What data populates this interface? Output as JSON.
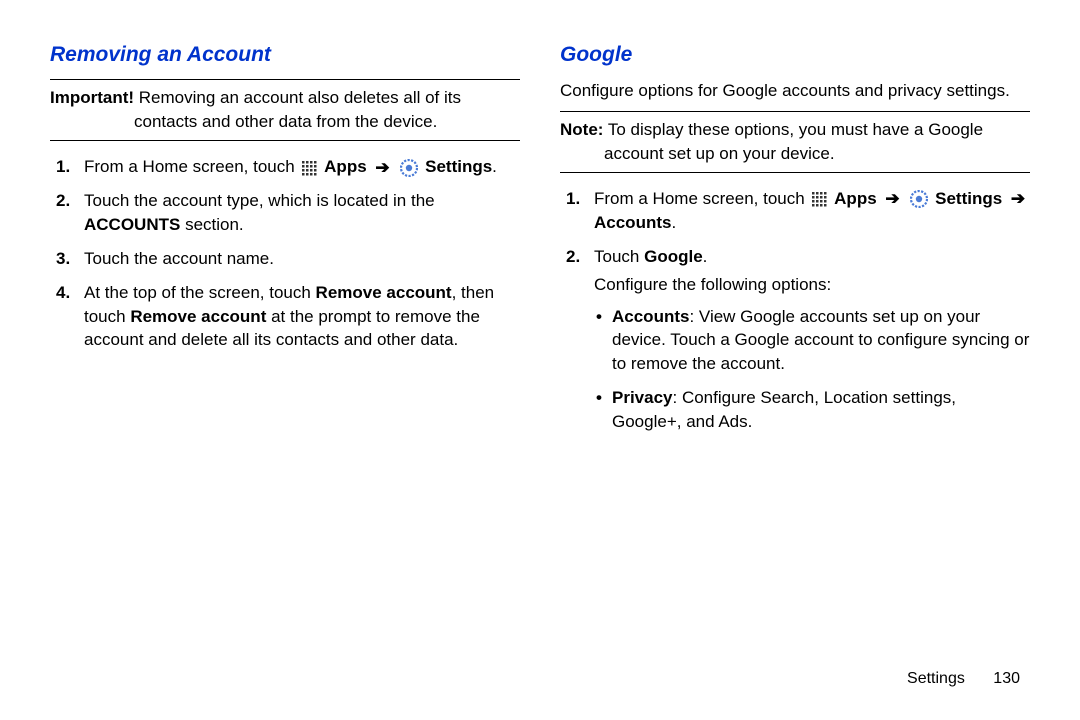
{
  "left": {
    "heading": "Removing an Account",
    "important_label": "Important!",
    "important_text": " Removing an account also deletes all of its contacts and other data from the device.",
    "step1_prefix": "From a Home screen, touch ",
    "nav_apps": "Apps",
    "nav_settings": "Settings",
    "nav_arrow": "➔",
    "step1_suffix": ".",
    "step2_a": "Touch the account type, which is located in the ",
    "step2_b": "ACCOUNTS",
    "step2_c": " section.",
    "step3": "Touch the account name.",
    "step4_a": "At the top of the screen, touch ",
    "step4_b": "Remove account",
    "step4_c": ", then touch ",
    "step4_d": "Remove account",
    "step4_e": " at the prompt to remove the account and delete all its contacts and other data."
  },
  "right": {
    "heading": "Google",
    "intro": "Configure options for Google accounts and privacy settings.",
    "note_label": "Note:",
    "note_text": " To display these options, you must have a Google account set up on your device.",
    "step1_prefix": "From a Home screen, touch ",
    "nav_apps": "Apps",
    "nav_settings": "Settings",
    "nav_accounts": "Accounts",
    "nav_arrow": "➔",
    "step1_suffix": ".",
    "step2_a": "Touch ",
    "step2_b": "Google",
    "step2_c": ".",
    "configure_label": "Configure the following options:",
    "bullet1_a": "Accounts",
    "bullet1_b": ": View Google accounts set up on your device. Touch a Google account to configure syncing or to remove the account.",
    "bullet2_a": "Privacy",
    "bullet2_b": ": Configure Search, Location settings, Google+, and Ads."
  },
  "footer": {
    "section": "Settings",
    "page": "130"
  }
}
